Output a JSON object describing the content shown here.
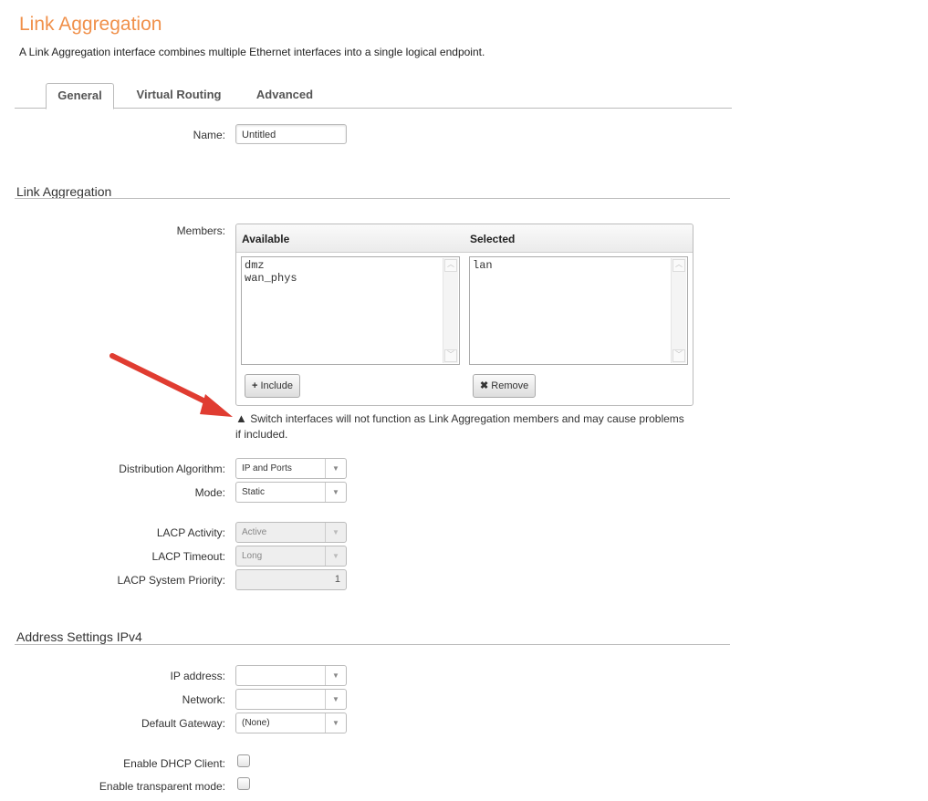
{
  "header": {
    "title": "Link Aggregation",
    "description": "A Link Aggregation interface combines multiple Ethernet interfaces into a single logical endpoint."
  },
  "tabs": [
    {
      "label": "General",
      "active": true
    },
    {
      "label": "Virtual Routing"
    },
    {
      "label": "Advanced"
    }
  ],
  "name": {
    "label": "Name:",
    "value": "Untitled"
  },
  "link_aggregation": {
    "section_title": "Link Aggregation",
    "members_label": "Members:",
    "available_header": "Available",
    "selected_header": "Selected",
    "available": [
      "dmz",
      "wan_phys"
    ],
    "selected": [
      "lan"
    ],
    "include_label": "Include",
    "remove_label": "Remove",
    "warning_line1": "Switch interfaces will not function as Link Aggregation members and may cause problems",
    "warning_line2": "if included.",
    "distribution_label": "Distribution Algorithm:",
    "distribution_value": "IP and Ports",
    "mode_label": "Mode:",
    "mode_value": "Static",
    "lacp_activity_label": "LACP Activity:",
    "lacp_activity_value": "Active",
    "lacp_timeout_label": "LACP Timeout:",
    "lacp_timeout_value": "Long",
    "lacp_priority_label": "LACP System Priority:",
    "lacp_priority_value": "1"
  },
  "ipv4": {
    "section_title": "Address Settings IPv4",
    "ip_label": "IP address:",
    "ip_value": "",
    "network_label": "Network:",
    "network_value": "",
    "gateway_label": "Default Gateway:",
    "gateway_value": "(None)",
    "dhcp_label": "Enable DHCP Client:",
    "transparent_label": "Enable transparent mode:"
  },
  "colors": {
    "title": "#f0904a",
    "arrow": "#e03c31"
  }
}
